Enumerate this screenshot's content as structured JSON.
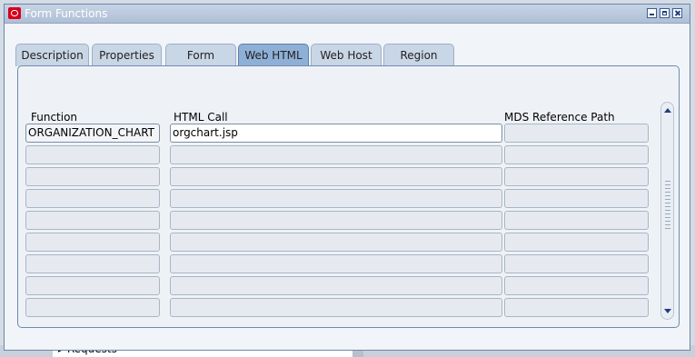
{
  "window": {
    "title": "Form Functions"
  },
  "tabs": [
    {
      "label": "Description",
      "active": false
    },
    {
      "label": "Properties",
      "active": false
    },
    {
      "label": "Form",
      "active": false
    },
    {
      "label": "Web HTML",
      "active": true
    },
    {
      "label": "Web Host",
      "active": false
    },
    {
      "label": "Region",
      "active": false
    }
  ],
  "columns": {
    "function": "Function",
    "html_call": "HTML Call",
    "mds_path": "MDS Reference Path"
  },
  "rows": [
    {
      "function": "ORGANIZATION_CHART",
      "html_call": "orgchart.jsp",
      "mds_path": ""
    },
    {
      "function": "",
      "html_call": "",
      "mds_path": ""
    },
    {
      "function": "",
      "html_call": "",
      "mds_path": ""
    },
    {
      "function": "",
      "html_call": "",
      "mds_path": ""
    },
    {
      "function": "",
      "html_call": "",
      "mds_path": ""
    },
    {
      "function": "",
      "html_call": "",
      "mds_path": ""
    },
    {
      "function": "",
      "html_call": "",
      "mds_path": ""
    },
    {
      "function": "",
      "html_call": "",
      "mds_path": ""
    },
    {
      "function": "",
      "html_call": "",
      "mds_path": ""
    }
  ],
  "background": {
    "requests_label": "Requests"
  },
  "icons": {
    "app": "oracle-app-icon",
    "min": "minimize-icon",
    "max": "maximize-icon",
    "close": "close-icon",
    "up": "scroll-up-arrow-icon",
    "down": "scroll-down-arrow-icon"
  }
}
